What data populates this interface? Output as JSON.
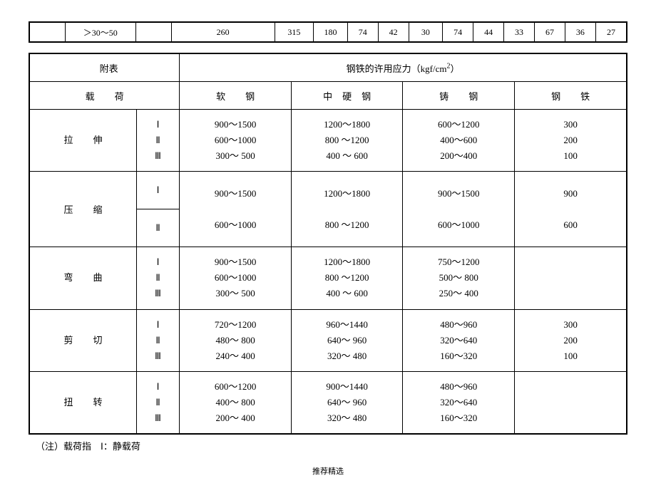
{
  "topStrip": {
    "range": "＞30～50",
    "v3": "260",
    "v4": "315",
    "v5": "180",
    "v6": "74",
    "v7": "42",
    "v8": "30",
    "v9": "74",
    "v10": "44",
    "v11": "33",
    "v12": "67",
    "v13": "36",
    "v14": "27"
  },
  "mainTitle": {
    "left": "附表",
    "center_pre": "钢铁的许用应力（kgf/cm",
    "center_sup": "2",
    "center_post": "）"
  },
  "headers": {
    "load": "载荷",
    "soft": "软钢",
    "midhard": "中硬钢",
    "cast": "铸钢",
    "iron": "钢铁"
  },
  "rows": {
    "tension": {
      "name": "拉伸",
      "levels": "Ⅰ\nⅡ\nⅢ",
      "soft": "900～1500\n600～1000\n300～ 500",
      "mid": "1200～1800\n800 ～1200\n400 ～ 600",
      "cast": "600～1200\n400～600\n200～400",
      "iron": "300\n200\n100"
    },
    "compression": {
      "name": "压缩",
      "lv1": "Ⅰ",
      "lv2": "Ⅱ",
      "soft1": "900～1500",
      "soft2": "600～1000",
      "mid1": "1200～1800",
      "mid2": "800 ～1200",
      "cast1": "900～1500",
      "cast2": "600～1000",
      "iron1": "900",
      "iron2": "600"
    },
    "bending": {
      "name": "弯曲",
      "levels": "Ⅰ\nⅡ\nⅢ",
      "soft": "900～1500\n600～1000\n300～ 500",
      "mid": "1200～1800\n800 ～1200\n400 ～ 600",
      "cast": "750～1200\n500～ 800\n250～ 400",
      "iron": ""
    },
    "shear": {
      "name": "剪切",
      "levels": "Ⅰ\nⅡ\nⅢ",
      "soft": "720～1200\n480～ 800\n240～ 400",
      "mid": "960～1440\n640～ 960\n320～ 480",
      "cast": "480～960\n320～640\n160～320",
      "iron": "300\n200\n100"
    },
    "torsion": {
      "name": "扭转",
      "levels": "Ⅰ\nⅡ\nⅢ",
      "soft": "600～1200\n400～ 800\n200～ 400",
      "mid": "900～1440\n640～ 960\n320～ 480",
      "cast": "480～960\n320～640\n160～320",
      "iron": ""
    }
  },
  "note": "（注）载荷指　Ⅰ：静载荷",
  "footer": "推荐精选"
}
